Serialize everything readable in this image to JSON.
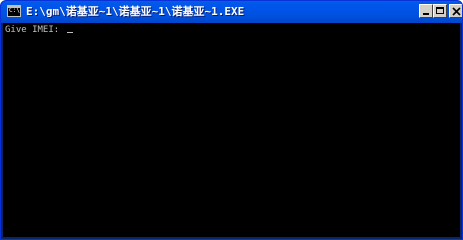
{
  "window": {
    "title": "E:\\gm\\诺基亚~1\\诺基亚~1\\诺基亚~1.EXE",
    "icon": "console-app-icon",
    "icon_label": "C:\\"
  },
  "controls": {
    "minimize_icon": "minimize-icon",
    "maximize_icon": "maximize-icon",
    "close_icon": "close-icon"
  },
  "console": {
    "prompt": "Give IMEI: ",
    "background": "#000000",
    "foreground": "#c0c0c0"
  },
  "colors": {
    "titlebar": "#0054e3",
    "button_face": "#d4d0c8"
  }
}
